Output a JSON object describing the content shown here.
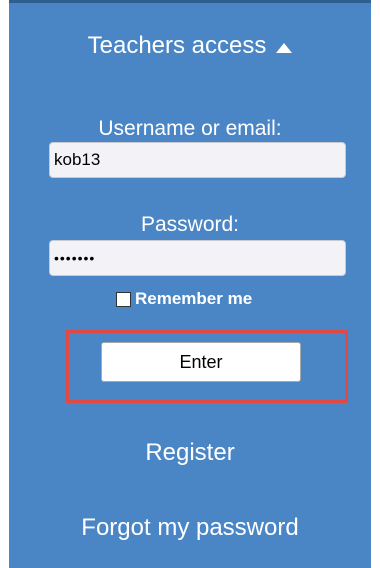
{
  "header": {
    "title": "Teachers access"
  },
  "login_form": {
    "username_label": "Username or email:",
    "username_value": "kob13",
    "password_label": "Password:",
    "password_value": "•••••••",
    "remember_label": "Remember me",
    "remember_checked": false,
    "enter_label": "Enter"
  },
  "links": {
    "register": "Register",
    "forgot_password": "Forgot my password"
  },
  "colors": {
    "panel_background": "#4a86c5",
    "highlight_border": "#e14a44"
  },
  "icons": {
    "collapse": "caret-up-icon"
  }
}
